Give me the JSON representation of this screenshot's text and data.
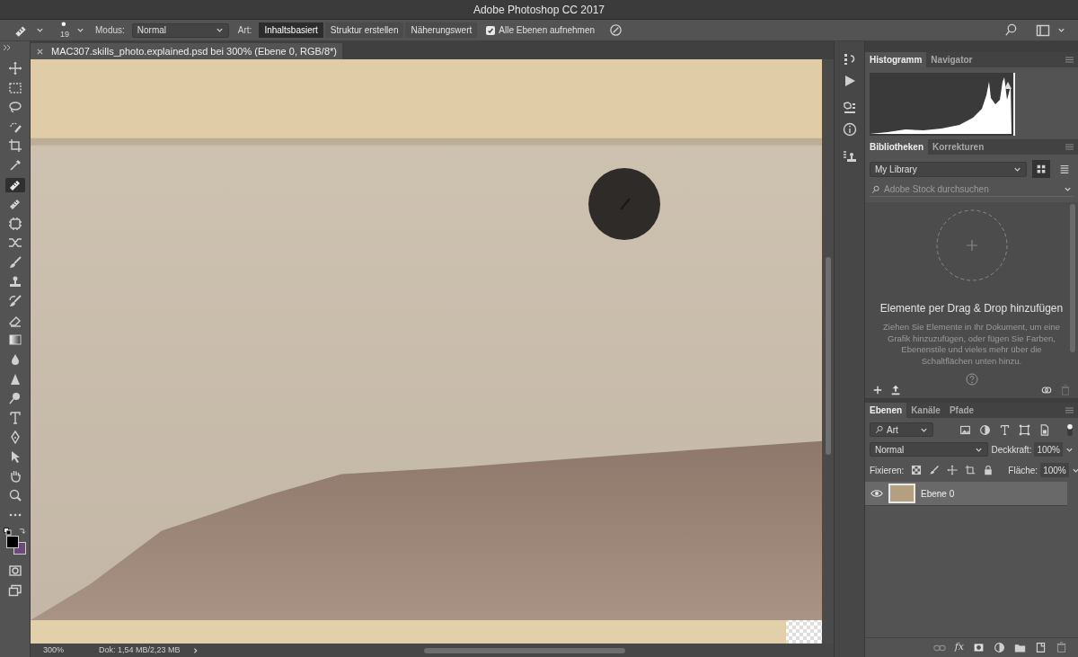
{
  "window": {
    "title": "Adobe Photoshop CC 2017"
  },
  "options_bar": {
    "brush_size": "19",
    "mode_label": "Modus:",
    "mode": "Normal",
    "type_label": "Art:",
    "type_options": [
      {
        "label": "Inhaltsbasiert",
        "selected": true
      },
      {
        "label": "Struktur erstellen",
        "selected": false
      },
      {
        "label": "Näherungswert",
        "selected": false
      }
    ],
    "sample_all": {
      "label": "Alle Ebenen aufnehmen",
      "checked": true
    }
  },
  "tools": [
    {
      "kind": "move",
      "selected": false
    },
    {
      "kind": "marquee",
      "selected": false
    },
    {
      "kind": "lasso",
      "selected": false
    },
    {
      "kind": "quick-select",
      "selected": false
    },
    {
      "kind": "crop",
      "selected": false
    },
    {
      "kind": "eyedropper",
      "selected": false
    },
    {
      "kind": "spot-healing",
      "selected": true
    },
    {
      "kind": "healing",
      "selected": false
    },
    {
      "kind": "patch",
      "selected": false
    },
    {
      "kind": "content-move",
      "selected": false
    },
    {
      "kind": "brush",
      "selected": false
    },
    {
      "kind": "stamp",
      "selected": false
    },
    {
      "kind": "history-brush",
      "selected": false
    },
    {
      "kind": "eraser",
      "selected": false
    },
    {
      "kind": "gradient",
      "selected": false
    },
    {
      "kind": "blur",
      "selected": false
    },
    {
      "kind": "sharpen",
      "selected": false
    },
    {
      "kind": "dodge",
      "selected": false
    },
    {
      "kind": "type",
      "selected": false
    },
    {
      "kind": "pen",
      "selected": false
    },
    {
      "kind": "path-select",
      "selected": false
    },
    {
      "kind": "hand",
      "selected": false
    },
    {
      "kind": "zoom",
      "selected": false
    },
    {
      "kind": "more",
      "selected": false
    }
  ],
  "document": {
    "tab": "MAC307.skills_photo.explained.psd bei 300% (Ebene 0, RGB/8*)"
  },
  "status_bar": {
    "zoom": "300%",
    "doc_info": "Dok: 1,54 MB/2,23 MB"
  },
  "histogram_panel": {
    "tabs": [
      {
        "label": "Histogramm",
        "selected": true
      },
      {
        "label": "Navigator",
        "selected": false
      }
    ]
  },
  "libraries_panel": {
    "tabs": [
      {
        "label": "Bibliotheken",
        "selected": true
      },
      {
        "label": "Korrekturen",
        "selected": false
      }
    ],
    "library": "My Library",
    "views": [
      {
        "kind": "grid",
        "selected": true
      },
      {
        "kind": "list",
        "selected": false
      }
    ],
    "search": {
      "placeholder": "Adobe Stock durchsuchen"
    },
    "empty_title": "Elemente per Drag & Drop hinzufügen",
    "empty_text": "Ziehen Sie Elemente in Ihr Dokument, um eine Grafik hinzuzufügen, oder fügen Sie Farben, Ebenenstile und vieles mehr über die Schaltflächen unten hinzu."
  },
  "layers_panel": {
    "tabs": [
      {
        "label": "Ebenen",
        "selected": true
      },
      {
        "label": "Kanäle",
        "selected": false
      },
      {
        "label": "Pfade",
        "selected": false
      }
    ],
    "filter": "Art",
    "blend_mode": "Normal",
    "opacity_label": "Deckkraft:",
    "opacity": "100%",
    "lock_label": "Fixieren:",
    "fill_label": "Fläche:",
    "fill": "100%",
    "layers": [
      {
        "name": "Ebene 0",
        "visible": true,
        "selected": true
      }
    ],
    "fx_label": "fx"
  }
}
